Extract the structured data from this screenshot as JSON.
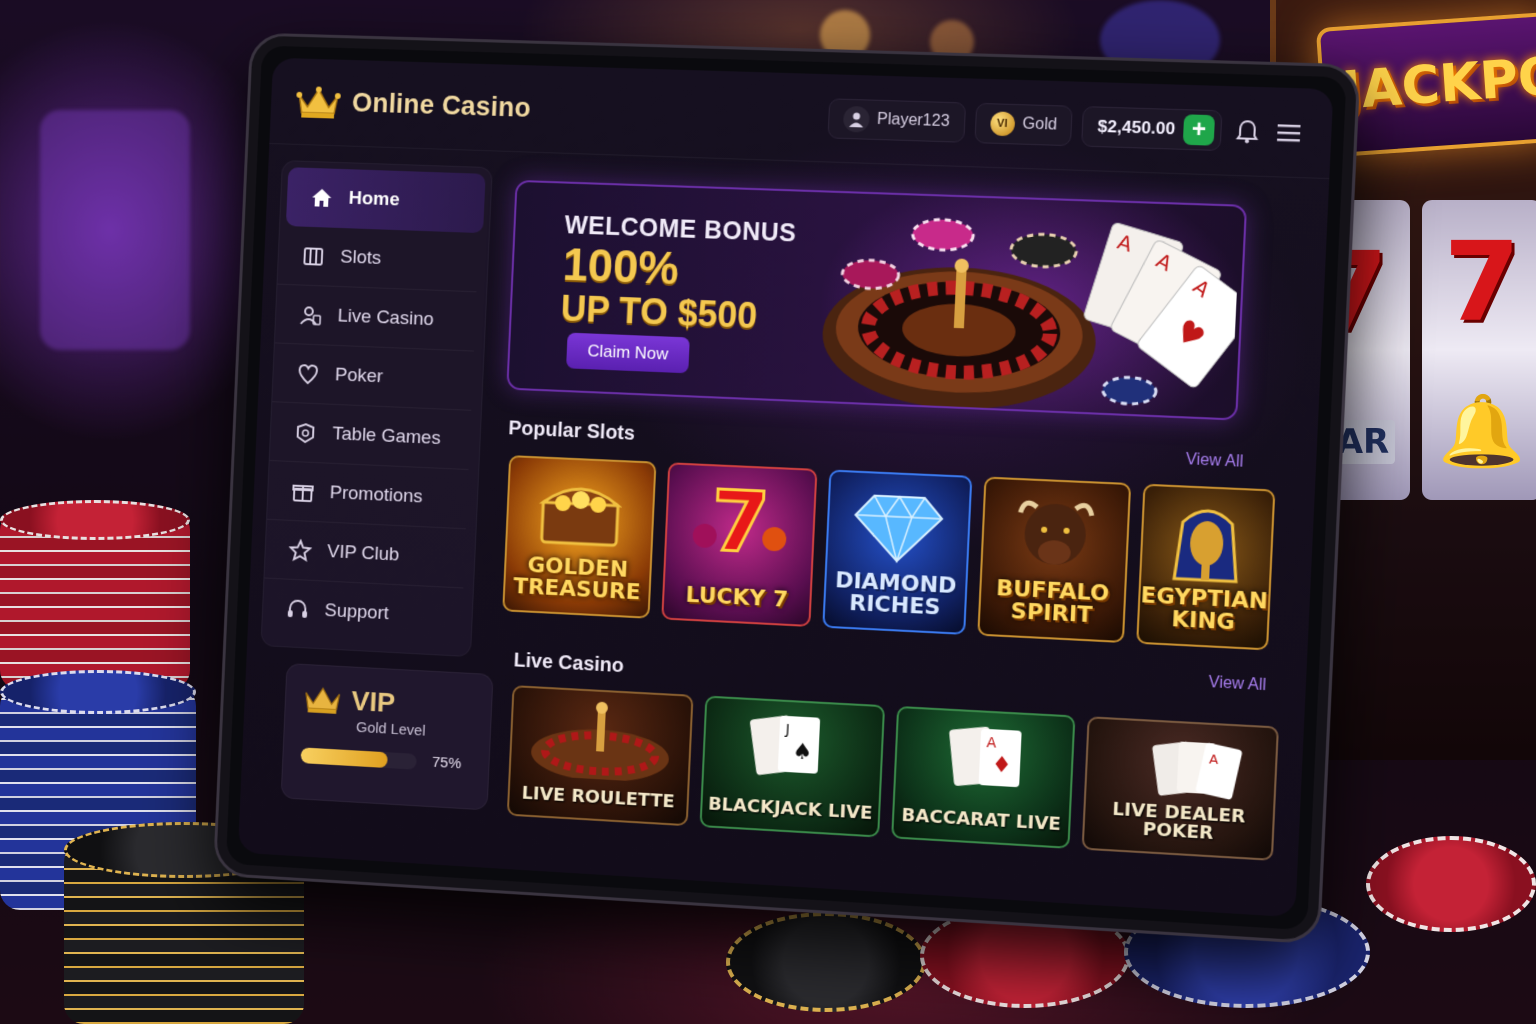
{
  "background": {
    "jackpot_sign": "JACKPO",
    "reel_symbols": [
      "7",
      "BAR",
      "7",
      "bell-icon"
    ]
  },
  "header": {
    "brand_icon": "crown-icon",
    "brand_name": "Online Casino",
    "username": "Player123",
    "tier_badge": "Gold",
    "balance": "$2,450.00",
    "add_funds_label": "+",
    "icons": [
      "bell-icon",
      "menu-icon"
    ]
  },
  "sidebar": {
    "items": [
      {
        "label": "Home",
        "icon": "home-icon",
        "active": true
      },
      {
        "label": "Slots",
        "icon": "slots-icon"
      },
      {
        "label": "Live Casino",
        "icon": "live-casino-icon"
      },
      {
        "label": "Poker",
        "icon": "poker-icon"
      },
      {
        "label": "Table Games",
        "icon": "table-games-icon"
      },
      {
        "label": "Promotions",
        "icon": "gift-icon"
      },
      {
        "label": "VIP Club",
        "icon": "star-icon"
      },
      {
        "label": "Support",
        "icon": "headset-icon"
      }
    ]
  },
  "vip": {
    "title": "VIP",
    "level": "Gold Level",
    "progress_text": "75%",
    "progress": 0.75
  },
  "banner": {
    "line1": "WELCOME BONUS",
    "line2": "100%",
    "line3": "UP TO $500",
    "cta": "Claim Now"
  },
  "popular_slots": {
    "title": "Popular Slots",
    "view_all": "View All",
    "games": [
      {
        "name": "GOLDEN TREASURE",
        "art": "treasure-chest-icon"
      },
      {
        "name": "LUCKY 7",
        "art": "seven-icon"
      },
      {
        "name": "DIAMOND RICHES",
        "art": "diamond-icon"
      },
      {
        "name": "BUFFALO SPIRIT",
        "art": "buffalo-icon"
      },
      {
        "name": "EGYPTIAN KING",
        "art": "pharaoh-icon"
      }
    ]
  },
  "live_casino": {
    "title": "Live Casino",
    "view_all": "View All",
    "games": [
      {
        "name": "LIVE ROULETTE",
        "art": "roulette-icon"
      },
      {
        "name": "BLACKJACK LIVE",
        "art": "cards-icon"
      },
      {
        "name": "BACCARAT LIVE",
        "art": "cards-icon"
      },
      {
        "name": "LIVE DEALER POKER",
        "art": "cards-icon"
      }
    ]
  },
  "colors": {
    "accent_purple": "#6b2fa8",
    "gold": "#f4c850",
    "add_green": "#1fa64a"
  }
}
